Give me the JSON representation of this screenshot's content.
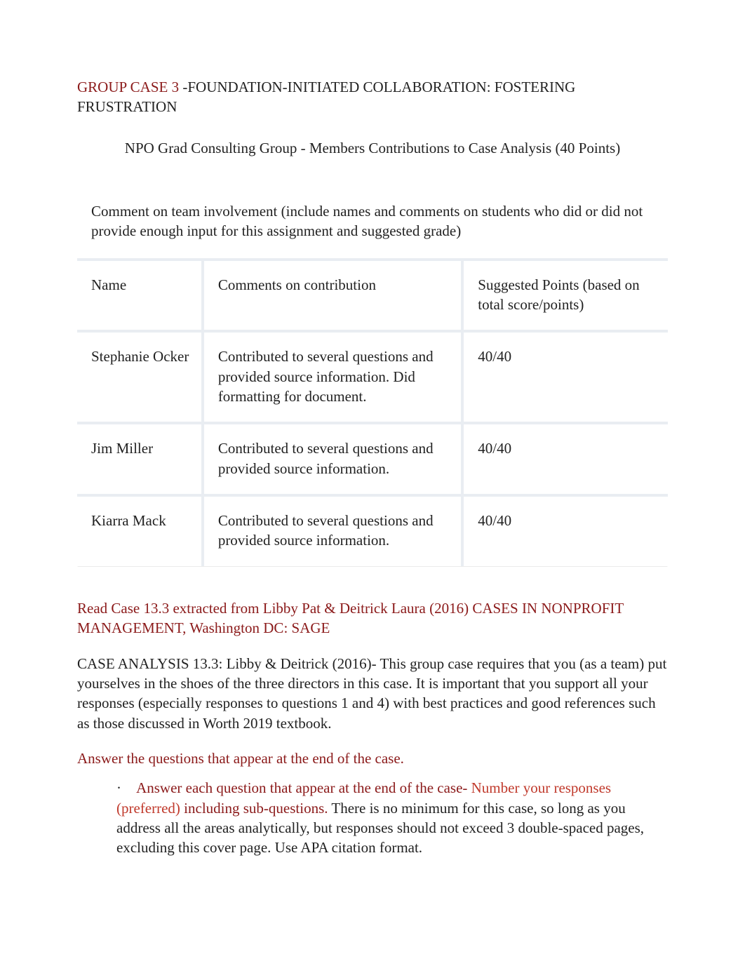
{
  "title": {
    "case_no": "GROUP CASE 3",
    "dash": " -",
    "rest": "FOUNDATION-INITIATED COLLABORATION: FOSTERING FRUSTRATION"
  },
  "subtitle": "NPO Grad Consulting Group - Members Contributions to Case Analysis (40 Points)",
  "table": {
    "header_text": "Comment on team involvement (include names and comments on students who did or did not provide enough input for this assignment and suggested grade)",
    "col_name": "Name",
    "col_comments": "Comments on contribution",
    "col_points": "Suggested Points (based on total score/points)",
    "rows": [
      {
        "name": "Stephanie Ocker",
        "comment": "Contributed to several questions and provided source information. Did formatting for document.",
        "points": "40/40"
      },
      {
        "name": "Jim Miller",
        "comment": "Contributed to several questions and provided source information.",
        "points": "40/40"
      },
      {
        "name": "Kiarra Mack",
        "comment": "Contributed to several questions and provided source information.",
        "points": "40/40"
      }
    ]
  },
  "reading": {
    "lead": "Read Case 13.3 extracted from ",
    "ref": "Libby Pat & Deitrick Laura (2016) CASES IN NONPROFIT MANAGEMENT, Washington DC: SAGE"
  },
  "case_analysis": "CASE ANALYSIS 13.3: Libby & Deitrick (2016)- This group case requires that you (as a team) put yourselves in the shoes of the three directors in this case. It is important that you support all your responses (especially responses to questions 1 and 4) with best practices and good references such as those discussed in Worth 2019 textbook.",
  "answer_heading": "Answer the questions that appear at the end of the case.",
  "bullet": {
    "dot": "·",
    "seg1": "Answer each question that appear at the end of the case- ",
    "seg2": "Number your responses (preferred) ",
    "seg3": "including sub-questions. ",
    "seg4": "There is no minimum for this case, so long as you address all the areas analytically, but responses should not exceed 3 double-spaced pages, excluding this cover page. Use APA citation format."
  }
}
